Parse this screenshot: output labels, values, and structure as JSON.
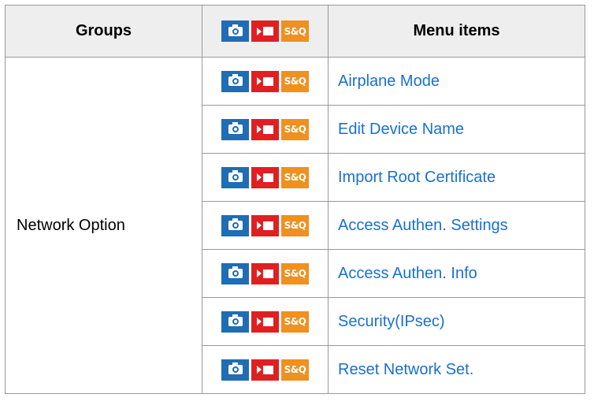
{
  "table": {
    "headers": {
      "groups": "Groups",
      "modes_icons": [
        "still-camera-icon",
        "movie-icon",
        "sq-icon"
      ],
      "menu_items": "Menu items"
    },
    "group_label": "Network Option",
    "mode_icon_text": {
      "sq": "S&Q"
    },
    "items": [
      {
        "label": "Airplane Mode"
      },
      {
        "label": "Edit Device Name"
      },
      {
        "label": "Import Root Certificate"
      },
      {
        "label": "Access Authen. Settings"
      },
      {
        "label": "Access Authen. Info"
      },
      {
        "label": "Security(IPsec)"
      },
      {
        "label": "Reset Network Set."
      }
    ]
  },
  "colors": {
    "still_icon": "#1e6db5",
    "movie_icon": "#e02020",
    "sq_icon": "#f0901e",
    "link": "#1a6fd1",
    "header_bg": "#eeeeee",
    "border": "#999999"
  }
}
